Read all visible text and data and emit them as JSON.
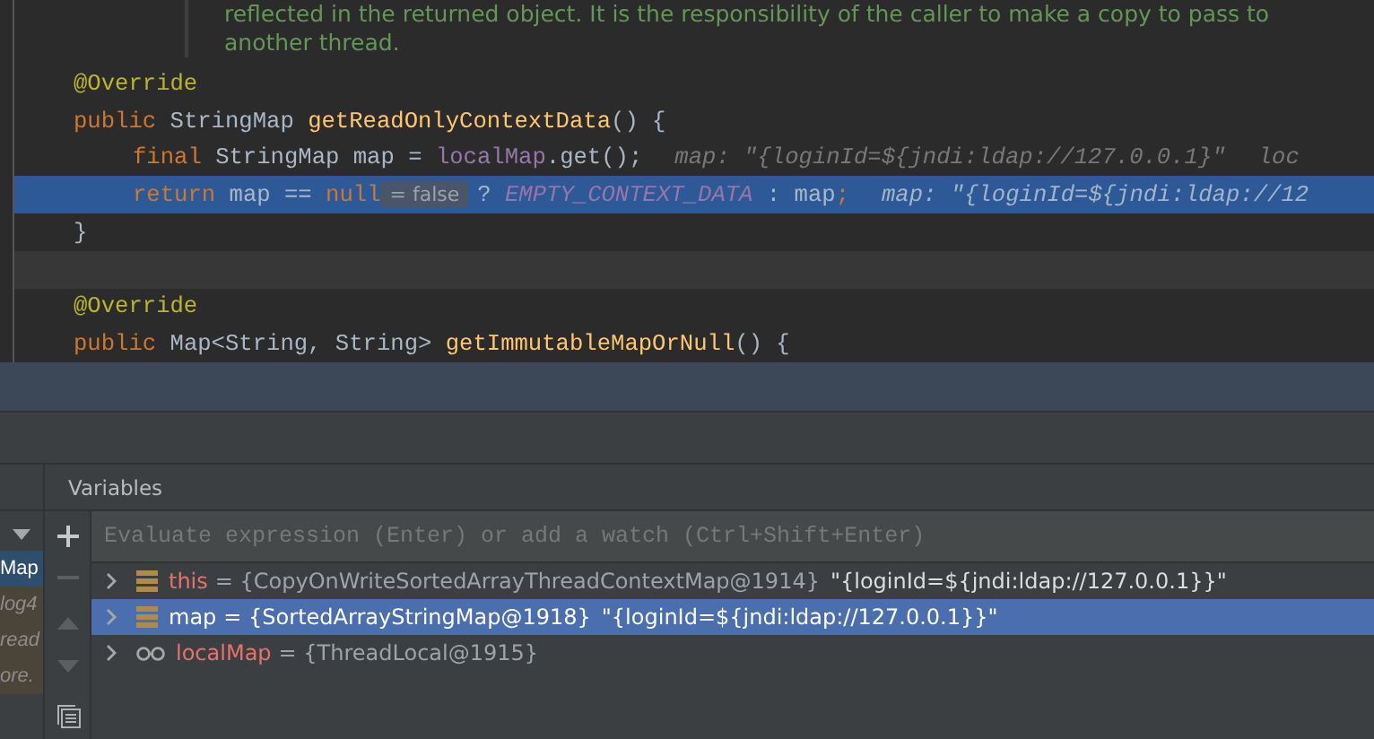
{
  "editor": {
    "doc_comment": [
      "reflected in the returned object. It is the responsibility of the caller to make a copy to pass to",
      "another thread."
    ],
    "lines": [
      {
        "execution": false,
        "caret": false,
        "indented": false,
        "segments": [
          {
            "kind": "code",
            "tokens": [
              {
                "kind": "annotation",
                "text": "@Override"
              }
            ]
          }
        ]
      },
      {
        "execution": false,
        "caret": false,
        "indented": false,
        "segments": [
          {
            "kind": "code",
            "tokens": [
              {
                "kind": "keyword",
                "text": "public "
              },
              {
                "kind": "plain",
                "text": "StringMap "
              },
              {
                "kind": "method",
                "text": "getReadOnlyContextData"
              },
              {
                "kind": "plain",
                "text": "() {"
              }
            ]
          }
        ]
      },
      {
        "execution": false,
        "caret": false,
        "indented": true,
        "segments": [
          {
            "kind": "code",
            "tokens": [
              {
                "kind": "keyword",
                "text": "final "
              },
              {
                "kind": "plain",
                "text": "StringMap map = "
              },
              {
                "kind": "field",
                "text": "localMap"
              },
              {
                "kind": "plain",
                "text": ".get();"
              }
            ]
          },
          {
            "kind": "hint",
            "text": "map: \"{loginId=${jndi:ldap://127.0.0.1}\""
          },
          {
            "kind": "hint",
            "text": "loc"
          }
        ]
      },
      {
        "execution": true,
        "caret": false,
        "indented": true,
        "segments": [
          {
            "kind": "code",
            "tokens": [
              {
                "kind": "keyword",
                "text": "return "
              },
              {
                "kind": "plain",
                "text": "map == "
              },
              {
                "kind": "keyword",
                "text": "null"
              }
            ]
          },
          {
            "kind": "badge",
            "text": "= false"
          },
          {
            "kind": "code",
            "tokens": [
              {
                "kind": "plain",
                "text": "? "
              },
              {
                "kind": "constant",
                "text": "EMPTY_CONTEXT_DATA"
              },
              {
                "kind": "plain",
                "text": " : map"
              },
              {
                "kind": "keyword",
                "text": ";"
              }
            ]
          },
          {
            "kind": "hint",
            "text": "map: \"{loginId=${jndi:ldap://12"
          }
        ]
      },
      {
        "execution": false,
        "caret": false,
        "indented": false,
        "segments": [
          {
            "kind": "code",
            "tokens": [
              {
                "kind": "plain",
                "text": "}"
              }
            ]
          }
        ]
      },
      {
        "execution": false,
        "caret": true
      },
      {
        "execution": false,
        "caret": false,
        "indented": false,
        "segments": [
          {
            "kind": "code",
            "tokens": [
              {
                "kind": "annotation",
                "text": "@Override"
              }
            ]
          }
        ]
      },
      {
        "execution": false,
        "caret": false,
        "indented": false,
        "segments": [
          {
            "kind": "code",
            "tokens": [
              {
                "kind": "keyword",
                "text": "public "
              },
              {
                "kind": "plain",
                "text": "Map<String, String> "
              },
              {
                "kind": "method",
                "text": "getImmutableMapOrNull"
              },
              {
                "kind": "plain",
                "text": "() {"
              }
            ]
          }
        ]
      }
    ]
  },
  "debugger": {
    "frames": [
      {
        "text": "Map",
        "selected": true
      },
      {
        "text": "log4",
        "selected": false
      },
      {
        "text": "read",
        "selected": false
      },
      {
        "text": "ore.",
        "selected": false
      }
    ],
    "panel_title": "Variables",
    "evaluate": {
      "placeholder": "Evaluate expression (Enter) or add a watch (Ctrl+Shift+Enter)"
    },
    "variables": [
      {
        "kind": "field",
        "name": "this",
        "value": "= {CopyOnWriteSortedArrayThreadContextMap@1914}",
        "string": "\"{loginId=${jndi:ldap://127.0.0.1}}\"",
        "selected": false
      },
      {
        "kind": "field",
        "name": "map",
        "value": "= {SortedArrayStringMap@1918}",
        "string": "\"{loginId=${jndi:ldap://127.0.0.1}}\"",
        "selected": true
      },
      {
        "kind": "watch",
        "name": "localMap",
        "value": "= {ThreadLocal@1915}",
        "selected": false
      }
    ]
  }
}
